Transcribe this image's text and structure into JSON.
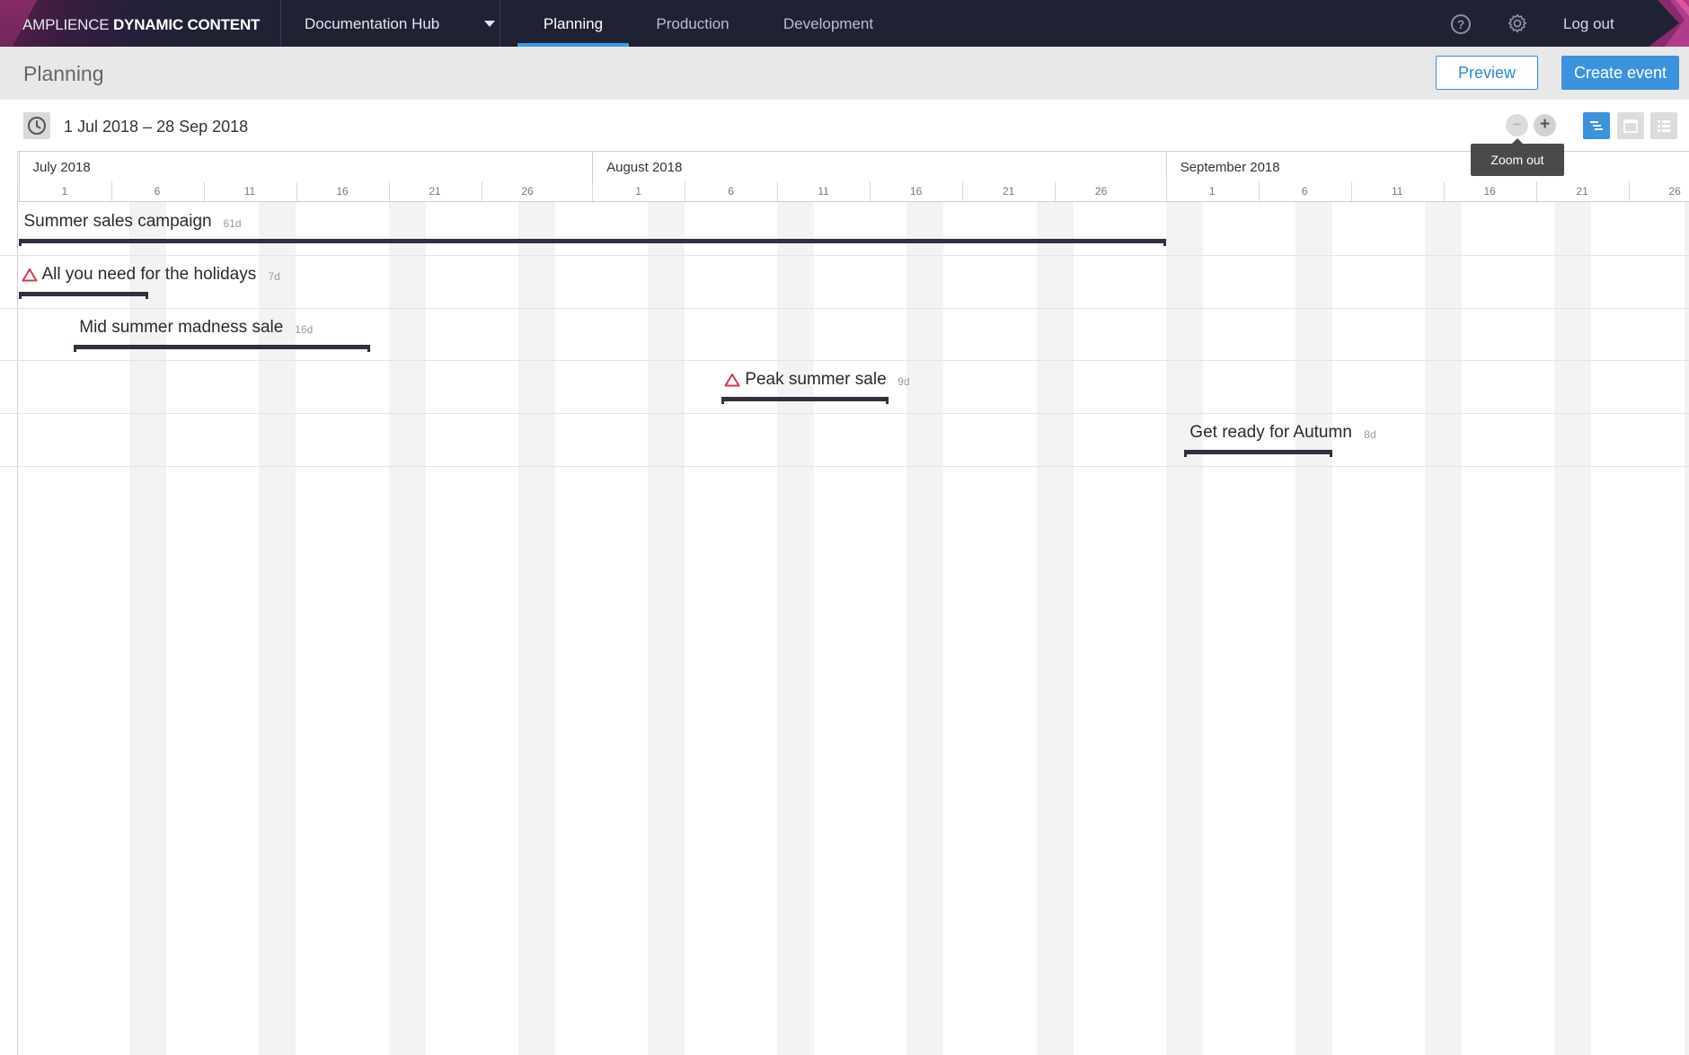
{
  "app": {
    "brand_light": "AMPLIENCE ",
    "brand_bold": "DYNAMIC CONTENT",
    "hub": "Documentation Hub",
    "tabs": [
      {
        "label": "Planning",
        "active": true
      },
      {
        "label": "Production",
        "active": false
      },
      {
        "label": "Development",
        "active": false
      }
    ],
    "help_icon": "?",
    "logout": "Log out",
    "accent_color": "#3c92dd"
  },
  "page": {
    "title": "Planning",
    "preview_label": "Preview",
    "create_label": "Create event"
  },
  "toolbar": {
    "date_range": "1 Jul 2018 – 28 Sep 2018",
    "zoom_out_symbol": "−",
    "zoom_in_symbol": "+",
    "tooltip": "Zoom out",
    "views": [
      "timeline-view-icon",
      "calendar-view-icon",
      "list-view-icon"
    ],
    "active_view": "timeline-view-icon"
  },
  "calendar": {
    "months": [
      {
        "label": "July 2018",
        "ticks": [
          "1",
          "6",
          "11",
          "16",
          "21",
          "26"
        ]
      },
      {
        "label": "August 2018",
        "ticks": [
          "1",
          "6",
          "11",
          "16",
          "21",
          "26"
        ]
      },
      {
        "label": "September 2018",
        "ticks": [
          "1",
          "6",
          "11",
          "16",
          "21",
          "26"
        ]
      }
    ]
  },
  "events": [
    {
      "name": "Summer sales campaign",
      "duration": "61d",
      "start": "2018-07-01",
      "end": "2018-08-31",
      "warning": false
    },
    {
      "name": "All you need for the holidays",
      "duration": "7d",
      "start": "2018-07-01",
      "end": "2018-07-07",
      "warning": true
    },
    {
      "name": "Mid summer madness sale",
      "duration": "16d",
      "start": "2018-07-04",
      "end": "2018-07-19",
      "warning": false
    },
    {
      "name": "Peak summer sale",
      "duration": "9d",
      "start": "2018-08-08",
      "end": "2018-08-16",
      "warning": true
    },
    {
      "name": "Get ready for Autumn",
      "duration": "8d",
      "start": "2018-09-02",
      "end": "2018-09-09",
      "warning": false
    }
  ]
}
